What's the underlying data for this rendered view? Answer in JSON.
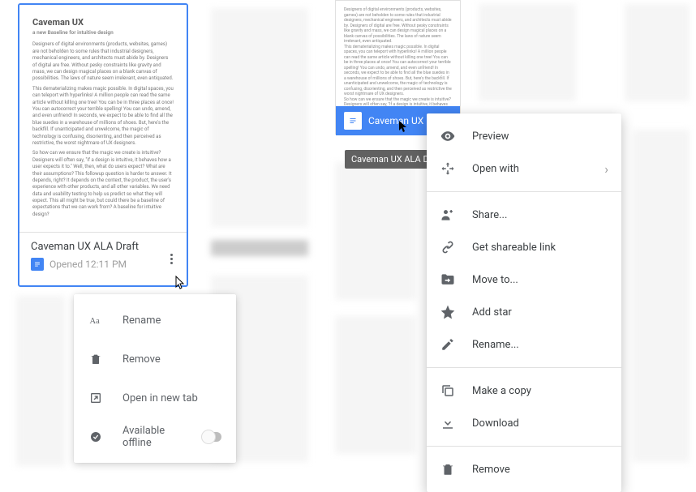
{
  "leftCard": {
    "title": "Caveman UX ALA Draft",
    "previewTitle": "Caveman UX",
    "previewSub": "a new Baseline for intuitive design",
    "openedLabel": "Opened 12:11 PM"
  },
  "smallMenu": {
    "rename": "Rename",
    "remove": "Remove",
    "newTab": "Open in new tab",
    "offline": "Available offline"
  },
  "rightCard": {
    "title": "Caveman UX",
    "tooltip": "Caveman UX ALA Draft"
  },
  "bigMenu": {
    "preview": "Preview",
    "openWith": "Open with",
    "share": "Share...",
    "shareLink": "Get shareable link",
    "moveTo": "Move to...",
    "addStar": "Add star",
    "rename": "Rename...",
    "copy": "Make a copy",
    "download": "Download",
    "remove": "Remove"
  }
}
